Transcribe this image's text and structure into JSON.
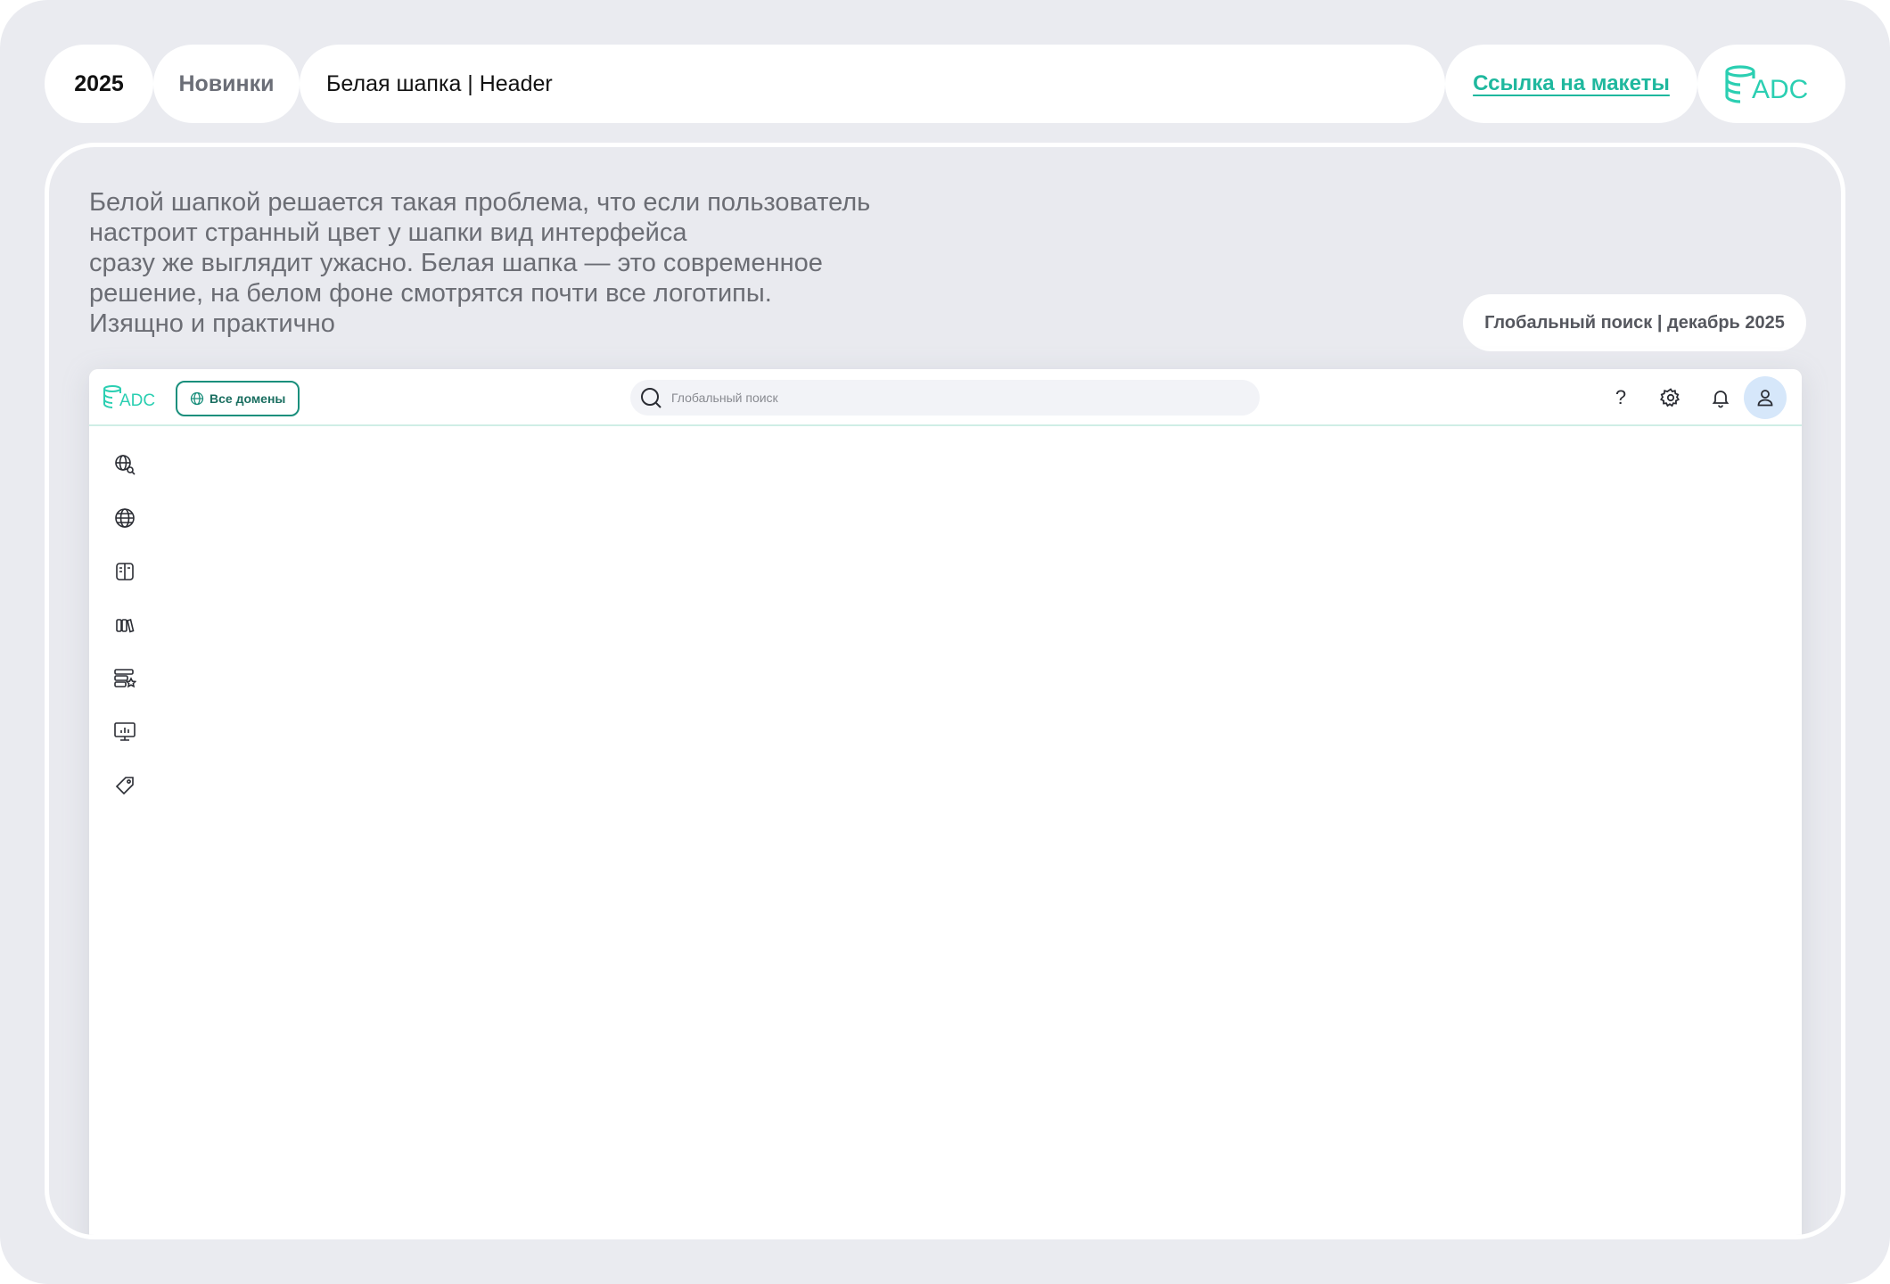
{
  "top_bar": {
    "year": "2025",
    "news_label": "Новинки",
    "title": "Белая шапка | Header",
    "link_label": "Ссылка на макеты",
    "logo_text": "ADC"
  },
  "card": {
    "description_lines": [
      "Белой шапкой решается такая проблема, что если пользователь",
      "настроит странный цвет у шапки вид интерфейса",
      "сразу же выглядит ужасно. Белая шапка — это современное",
      "решение, на белом фоне смотрятся почти все логотипы.",
      "Изящно и практично"
    ],
    "badge": "Глобальный поиск | декабрь 2025"
  },
  "app": {
    "logo_text": "ADC",
    "domains_button": "Все домены",
    "search_placeholder": "Глобальный поиск",
    "help_label": "?",
    "sidebar_icons": [
      "globe-search-icon",
      "globe-icon",
      "book-icon",
      "library-icon",
      "database-star-icon",
      "monitor-chart-icon",
      "tag-icon"
    ]
  },
  "colors": {
    "accent": "#1fb89e",
    "background": "#eaebf0",
    "avatar_bg": "#d6e7fa"
  }
}
